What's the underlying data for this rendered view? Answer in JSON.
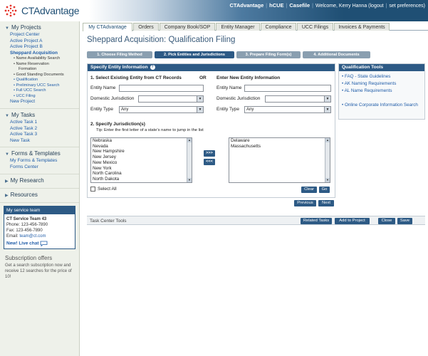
{
  "header": {
    "brand": "CTAdvantage",
    "nav": [
      "CTAdvantage",
      "hCUE",
      "Casefile"
    ],
    "welcome": "Welcome, Kerry Hanna",
    "logout": "logout",
    "preferences": "set preferences"
  },
  "tabs": [
    "My CTAdvantage",
    "Orders",
    "Company Book/SOP",
    "Entity Manager",
    "Compliance",
    "UCC Filings",
    "Invoices & Payments"
  ],
  "sidebar": {
    "projects_title": "My Projects",
    "projects": [
      {
        "label": "Project Center"
      },
      {
        "label": "Active Project A"
      },
      {
        "label": "Active Project B"
      },
      {
        "label": "Sheppard Acquisition"
      }
    ],
    "project_subitems": [
      {
        "label": "Name Availability Search",
        "indent": 1
      },
      {
        "label": "Name Reservation",
        "indent": 1
      },
      {
        "label": "Formation",
        "indent": 2
      },
      {
        "label": "Good Standing Documents",
        "indent": 1
      },
      {
        "label": "Qualification",
        "indent": 1
      },
      {
        "label": "Preliminary UCC Search",
        "indent": 2
      },
      {
        "label": "Full UCC Search",
        "indent": 1
      },
      {
        "label": "UCC Filing",
        "indent": 1
      }
    ],
    "new_project": "New Project",
    "tasks_title": "My Tasks",
    "tasks": [
      "Active Task 1",
      "Active Task 2",
      "Active Task 3",
      "New Task"
    ],
    "forms_title": "Forms & Templates",
    "forms": [
      "My Forms & Templates",
      "Forms Center"
    ],
    "research_title": "My Research",
    "resources_title": "Resources",
    "team": {
      "title": "My service team",
      "name": "CT Service Team 43",
      "phone": "Phone: 123-456-7890",
      "fax": "Fax: 123-456-7890",
      "email_label": "Email:",
      "email": "team@ct.com",
      "live_chat": "New! Live chat"
    },
    "offers": {
      "title": "Subscription offers",
      "body": "Get a search subscription now and receive 12 searches for the price of 10!"
    }
  },
  "main": {
    "page_title": "Sheppard Acquisition: Qualification Filing",
    "steps": [
      "1. Choose Filing Method",
      "2. Pick Entities and Jurisdictions",
      "3. Prepare Filing Form(s)",
      "4. Additional Documents"
    ],
    "active_step": 1,
    "panel_title": "Specify Entity Information",
    "existing_title": "1. Select Existing Entity from CT Records",
    "or_label": "OR",
    "new_title": "Enter New Entity Information",
    "entity_name": "Entity Name",
    "domestic_jurisdiction": "Domestic Jurisdiction",
    "entity_type": "Entity Type",
    "entity_type_value": "Any",
    "jurisdictions_title": "2. Specify Jurisdiction(s)",
    "tip": "Tip: Enter the first letter of a state's name to jump in the list",
    "available_states": [
      "Nebraska",
      "Nevada",
      "New Hampshire",
      "New Jersey",
      "New Mexico",
      "New York",
      "North Carolina",
      "North Dakota"
    ],
    "selected_states": [
      "Delaware",
      "Massachusetts"
    ],
    "add_btn": ">>>",
    "remove_btn": "<<<",
    "select_all": "Select All",
    "clear_btn": "Clear",
    "go_btn": "Go",
    "previous_btn": "Previous",
    "next_btn": "Next"
  },
  "tools": {
    "title": "Qualification Tools",
    "links": [
      "FAQ - State Guidelines",
      "AK Naming Requirements",
      "AL Name Requirements",
      "Online Corporate Information Search"
    ]
  },
  "taskbar": {
    "title": "Task Center Tools",
    "buttons": [
      "Related Tasks",
      "Add to Project",
      "Close",
      "Save"
    ]
  }
}
